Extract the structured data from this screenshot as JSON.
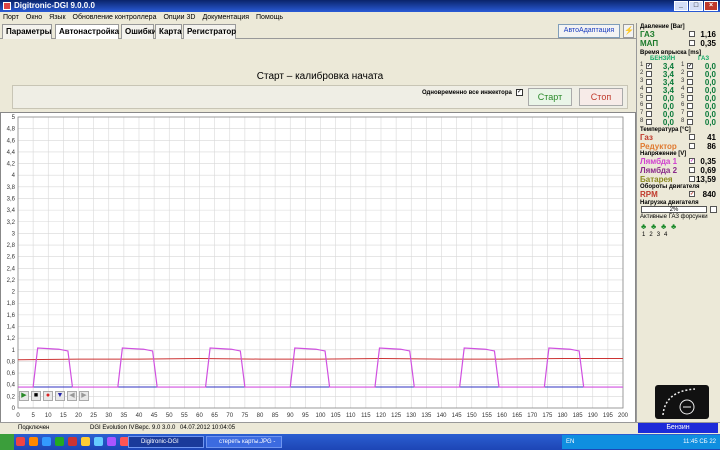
{
  "window": {
    "title": "Digitronic-DGI  9.0.0.0"
  },
  "menu": [
    "Порт",
    "Окно",
    "Язык",
    "Обновление контроллера",
    "Опции 3D",
    "Документация",
    "Помощь"
  ],
  "tabs": [
    "Параметры",
    "Автонастройка",
    "Ошибки",
    "Карта",
    "Регистратор"
  ],
  "auto_adapt": "АвтоАдаптация",
  "calibration": {
    "title": "Старт – калибровка начата",
    "simultaneous_label": "Одновременно все инжектора",
    "simultaneous_checked": "✓",
    "start": "Старт",
    "stop": "Стоп"
  },
  "chart_data": {
    "type": "line",
    "x_ticks": [
      "0",
      "5",
      "10",
      "15",
      "20",
      "25",
      "30",
      "35",
      "40",
      "45",
      "50",
      "55",
      "60",
      "65",
      "70",
      "75",
      "80",
      "85",
      "90",
      "95",
      "100",
      "105",
      "110",
      "115",
      "120",
      "125",
      "130",
      "135",
      "140",
      "145",
      "150",
      "155",
      "160",
      "165",
      "170",
      "175",
      "180",
      "185",
      "190",
      "195",
      "200"
    ],
    "y_ticks": [
      "0",
      "0,2",
      "0,4",
      "0,6",
      "0,8",
      "1",
      "1,2",
      "1,4",
      "1,6",
      "1,8",
      "2",
      "2,2",
      "2,4",
      "2,6",
      "2,8",
      "3",
      "3,2",
      "3,4",
      "3,6",
      "3,8",
      "4",
      "4,2",
      "4,4",
      "4,6",
      "4,8",
      "5"
    ],
    "xlim": [
      0,
      200
    ],
    "ylim": [
      0,
      5
    ],
    "grid": true,
    "series": [
      {
        "color": "#cc3333",
        "values_x": [
          0,
          20,
          40,
          60,
          80,
          100,
          120,
          140,
          160,
          180,
          200
        ],
        "values_y": [
          0.83,
          0.84,
          0.84,
          0.85,
          0.84,
          0.84,
          0.85,
          0.84,
          0.84,
          0.85,
          0.85
        ]
      },
      {
        "color": "#d050e0",
        "pulse_starts": [
          5,
          33,
          62,
          90,
          118,
          146,
          174
        ],
        "pulse_width": 10,
        "high": 1.03,
        "low": 0.36
      },
      {
        "color": "#3030c0",
        "values_x": [
          0,
          200
        ],
        "values_y": [
          0.36,
          0.36
        ]
      }
    ]
  },
  "side": {
    "pressure_title": "Давление [Bar]",
    "gas_label": "ГАЗ",
    "gas_value": "1,16",
    "map_label": "МАП",
    "map_value": "0,35",
    "inj_title": "Время впрыска [ms]",
    "inj_col_petrol": "БЕНЗИН",
    "inj_col_gas": "ГАЗ",
    "injectors": [
      {
        "n": "1",
        "petrol": "3,4",
        "gas": "0,0",
        "c1": "✓",
        "c2": "✓"
      },
      {
        "n": "2",
        "petrol": "3,4",
        "gas": "0,0",
        "c1": "",
        "c2": ""
      },
      {
        "n": "3",
        "petrol": "3,4",
        "gas": "0,0",
        "c1": "",
        "c2": ""
      },
      {
        "n": "4",
        "petrol": "3,4",
        "gas": "0,0",
        "c1": "",
        "c2": ""
      },
      {
        "n": "5",
        "petrol": "0,0",
        "gas": "0,0",
        "c1": "",
        "c2": ""
      },
      {
        "n": "6",
        "petrol": "0,0",
        "gas": "0,0",
        "c1": "",
        "c2": ""
      },
      {
        "n": "7",
        "petrol": "0,0",
        "gas": "0,0",
        "c1": "",
        "c2": ""
      },
      {
        "n": "8",
        "petrol": "0,0",
        "gas": "0,0",
        "c1": "",
        "c2": ""
      }
    ],
    "temp_title": "Температура [°C]",
    "temp_gas_label": "Газ",
    "temp_gas_value": "41",
    "temp_red_label": "Редуктор",
    "temp_red_value": "86",
    "volt_title": "Напряжение [V]",
    "lambda1_label": "Лямбда 1",
    "lambda1_value": "0,35",
    "lambda2_label": "Лямбда 2",
    "lambda2_value": "0,69",
    "battery_label": "Батарея",
    "battery_value": "13,59",
    "rpm_title": "Обороты двигателя",
    "rpm_label": "RPM",
    "rpm_value": "840",
    "load_title": "Нагрузка двигателя",
    "load_value": "2%",
    "active_inj_title": "Активные ГАЗ форсунки",
    "active_inj_nums": [
      "1",
      "2",
      "3",
      "4"
    ]
  },
  "status": {
    "connected": "Подключен",
    "device": "DGI Evolution IV",
    "version": "Верс. 9.0",
    "version2": "3.0.0",
    "datetime": "04.07.2012 10:04:05",
    "fuel": "Бензин"
  },
  "taskbar": {
    "items": [
      "Digitronic-DGI",
      "стереть карты.JPG -"
    ],
    "lang": "EN",
    "clock": "11:45 СБ 22"
  }
}
